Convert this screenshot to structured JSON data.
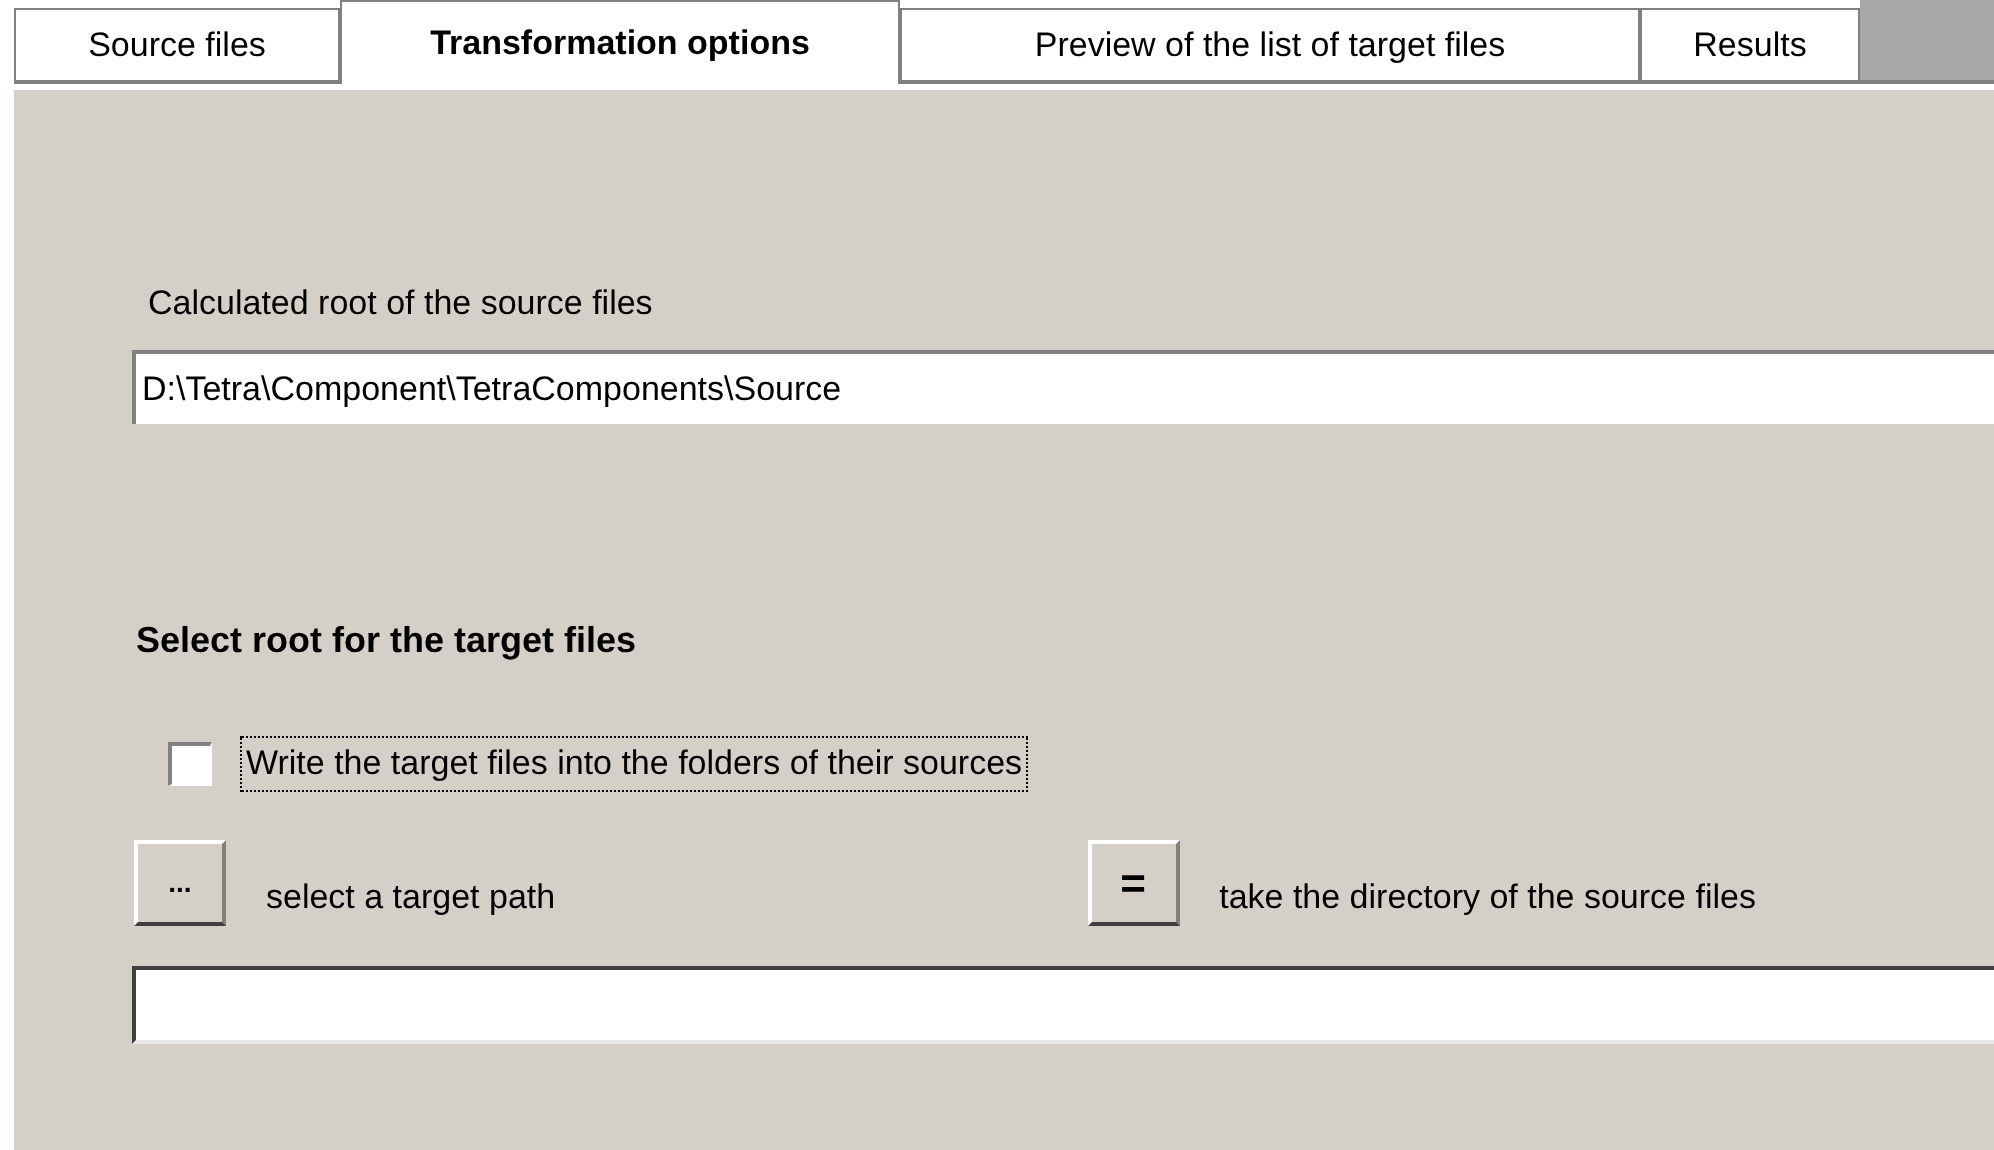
{
  "tabs": [
    {
      "label": "Source files",
      "selected": false
    },
    {
      "label": "Transformation options",
      "selected": true
    },
    {
      "label": "Preview of the list of target files",
      "selected": false
    },
    {
      "label": "Results",
      "selected": false
    }
  ],
  "source_root": {
    "label": "Calculated root of the source files",
    "value": "D:\\Tetra\\Component\\TetraComponents\\Source"
  },
  "target_section": {
    "heading": "Select root for the target files",
    "write_into_source_folders": {
      "label": "Write the target files into the folders of their sources",
      "checked": false
    },
    "browse_button": {
      "label": "...",
      "caption": "select a target path"
    },
    "equal_button": {
      "label": "=",
      "caption": "take the directory of the source files"
    }
  }
}
